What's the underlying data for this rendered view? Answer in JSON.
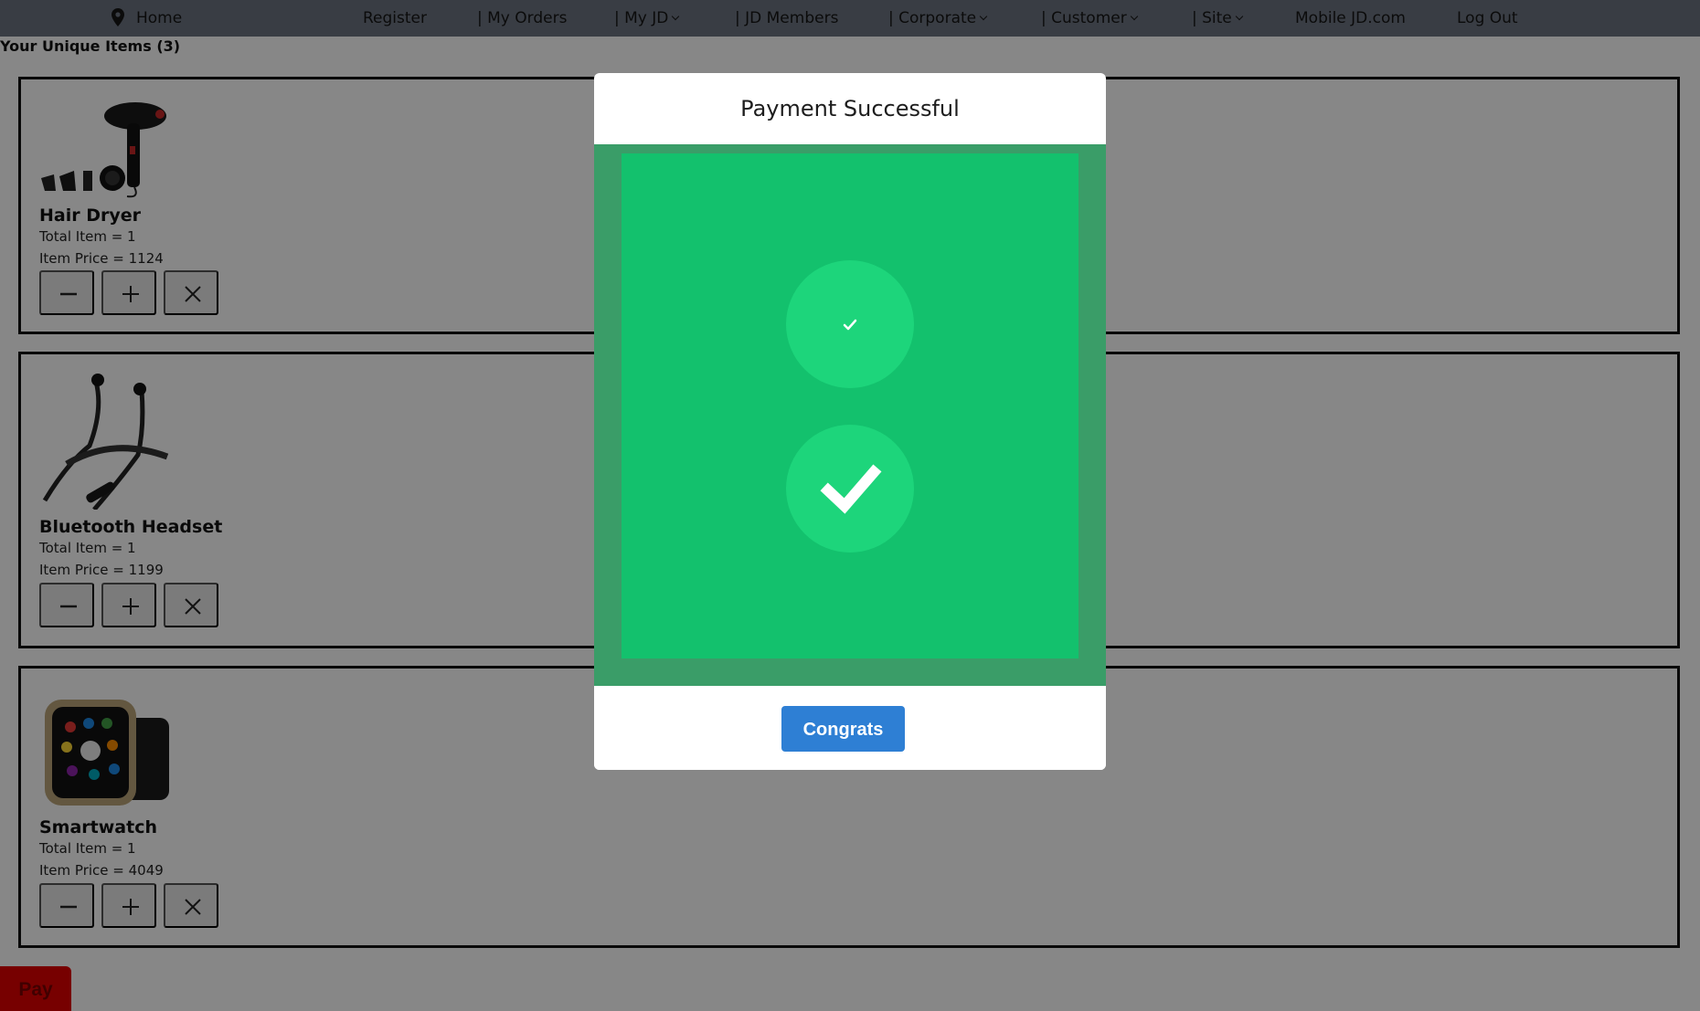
{
  "nav": {
    "items": [
      {
        "label": "Home"
      },
      {
        "label": "Register"
      },
      {
        "label": "| My Orders"
      },
      {
        "label": "| My JD"
      },
      {
        "label": "| JD Members"
      },
      {
        "label": "| Corporate"
      },
      {
        "label": "| Customer"
      },
      {
        "label": "| Site"
      },
      {
        "label": "Mobile JD.com"
      },
      {
        "label": "Log Out"
      }
    ]
  },
  "cart": {
    "heading": "Your Unique Items (3)",
    "items": [
      {
        "name": "Hair Dryer",
        "total": "Total Item = 1",
        "price": "Item Price = 1124"
      },
      {
        "name": "Bluetooth Headset",
        "total": "Total Item = 1",
        "price": "Item Price = 1199"
      },
      {
        "name": "Smartwatch",
        "total": "Total Item = 1",
        "price": "Item Price = 4049"
      }
    ],
    "pay_label": "Pay"
  },
  "modal": {
    "title": "Payment Successful",
    "button_label": "Congrats"
  },
  "colors": {
    "nav_bg": "#6c7480",
    "modal_green": "#13c16d",
    "modal_green_border": "#3a9d68",
    "check_circle": "#1dd57b",
    "congrats_blue": "#2e7fd4",
    "pay_red": "#e00000"
  }
}
